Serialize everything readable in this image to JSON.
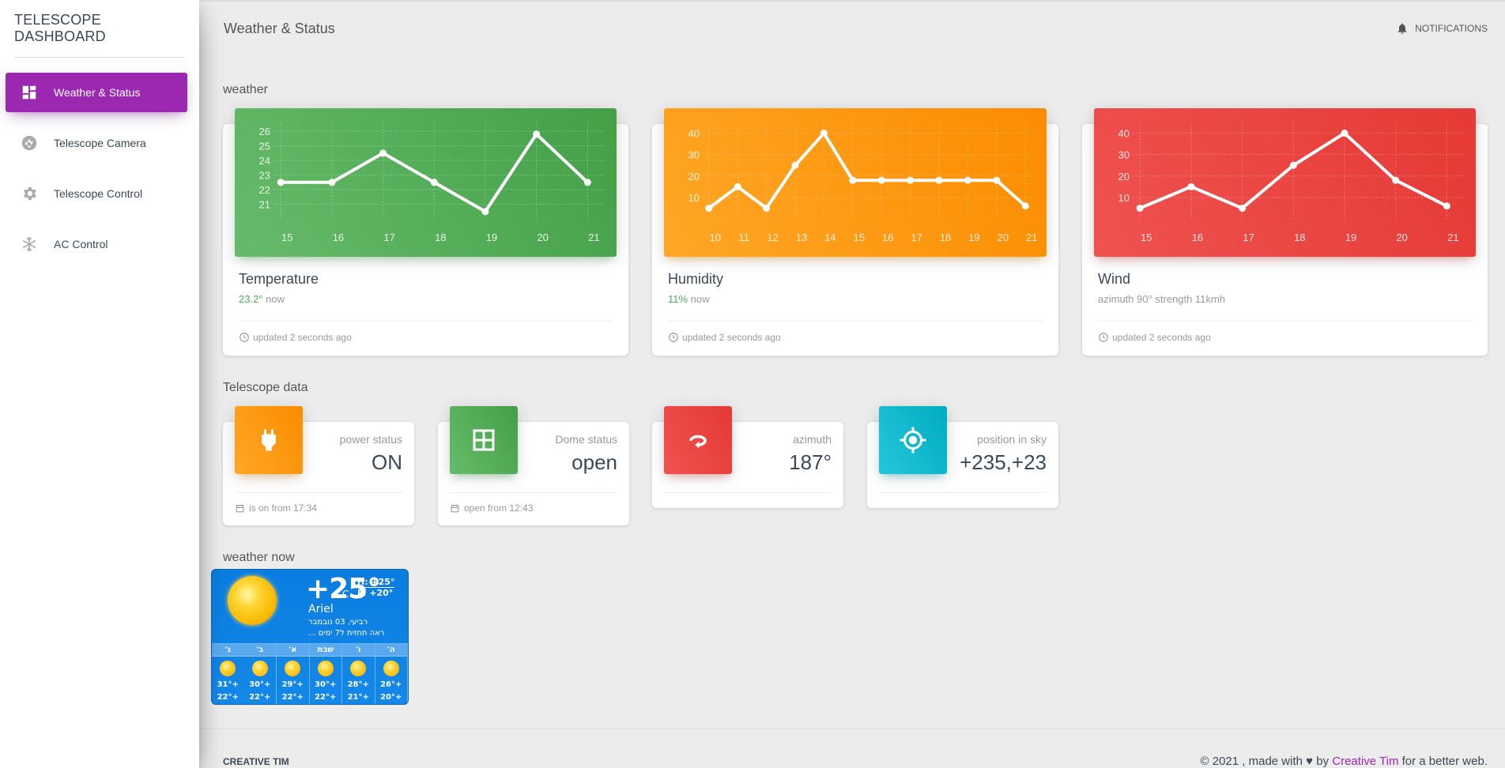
{
  "brand": "TELESCOPE DASHBOARD",
  "sidebar": {
    "items": [
      {
        "label": "Weather & Status",
        "icon": "dashboard-icon",
        "active": true
      },
      {
        "label": "Telescope Camera",
        "icon": "camera-shutter-icon"
      },
      {
        "label": "Telescope Control",
        "icon": "gear-icon"
      },
      {
        "label": "AC Control",
        "icon": "snowflake-icon"
      }
    ]
  },
  "header": {
    "title": "Weather & Status",
    "notifications_label": "NOTIFICATIONS"
  },
  "sections": {
    "weather": "weather",
    "telescope": "Telescope data",
    "weather_now": "weather now"
  },
  "weather_cards": [
    {
      "title": "Temperature",
      "highlight": "23.2°",
      "suffix": " now",
      "footer": "updated 2 seconds ago",
      "color": "#4caf50"
    },
    {
      "title": "Humidity",
      "highlight": "11%",
      "suffix": " now",
      "footer": "updated 2 seconds ago",
      "color": "#ff9800"
    },
    {
      "title": "Wind",
      "highlight": "",
      "suffix": "azimuth 90° strength 11kmh",
      "footer": "updated 2 seconds ago",
      "color": "#f44336"
    }
  ],
  "chart_data": [
    {
      "type": "line",
      "x": [
        "15",
        "16",
        "17",
        "18",
        "19",
        "20",
        "21"
      ],
      "series": [
        {
          "values": [
            22.5,
            22.5,
            24.5,
            22.5,
            20.5,
            25.8,
            22.5
          ]
        }
      ],
      "yticks": [
        21,
        22,
        23,
        24,
        25,
        26
      ],
      "ylim": [
        20,
        26.6
      ],
      "grid": true
    },
    {
      "type": "line",
      "x": [
        "10",
        "11",
        "12",
        "13",
        "14",
        "15",
        "16",
        "17",
        "18",
        "19",
        "20",
        "21"
      ],
      "series": [
        {
          "values": [
            5,
            15,
            5,
            25,
            40,
            18,
            18,
            18,
            18,
            18,
            18,
            6
          ]
        }
      ],
      "yticks": [
        10,
        20,
        30,
        40
      ],
      "ylim": [
        0,
        45
      ],
      "grid": true
    },
    {
      "type": "line",
      "x": [
        "15",
        "16",
        "17",
        "18",
        "19",
        "20",
        "21"
      ],
      "series": [
        {
          "values": [
            5,
            15,
            5,
            25,
            40,
            18,
            6
          ]
        }
      ],
      "yticks": [
        10,
        20,
        30,
        40
      ],
      "ylim": [
        0,
        45
      ],
      "grid": true
    }
  ],
  "stats": [
    {
      "category": "power status",
      "value": "ON",
      "footer": "is on from 17:34",
      "icon": "plug-icon",
      "color": "#ff9800"
    },
    {
      "category": "Dome status",
      "value": "open",
      "footer": "open from 12:43",
      "icon": "window-icon",
      "color": "#4caf50"
    },
    {
      "category": "azimuth",
      "value": "187°",
      "footer": "",
      "icon": "rotate-icon",
      "color": "#f44336"
    },
    {
      "category": "position in sky",
      "value": "+235,+23",
      "footer": "",
      "icon": "gps-target-icon",
      "color": "#00bcd4"
    }
  ],
  "weather_widget": {
    "temp": "+25°",
    "unit": "C",
    "high": "H: +25°",
    "low": "L: +20°",
    "city": "Ariel",
    "date": "רביעי, 03 נובמבר",
    "forecast_link": "ראה תחזית ל7 ימים ...",
    "days": [
      {
        "name": "ה'",
        "hi": "+26°",
        "lo": "+20°"
      },
      {
        "name": "ו'",
        "hi": "+28°",
        "lo": "+21°"
      },
      {
        "name": "שבת",
        "hi": "+30°",
        "lo": "+22°"
      },
      {
        "name": "א'",
        "hi": "+29°",
        "lo": "+22°"
      },
      {
        "name": "ב'",
        "hi": "+30°",
        "lo": "+22°"
      },
      {
        "name": "ג'",
        "hi": "+31°",
        "lo": "+22°"
      }
    ]
  },
  "footer": {
    "left": "CREATIVE TIM",
    "copyright": "© 2021 , made with",
    "by": " by ",
    "link": "Creative Tim",
    "tail": " for a better web."
  }
}
